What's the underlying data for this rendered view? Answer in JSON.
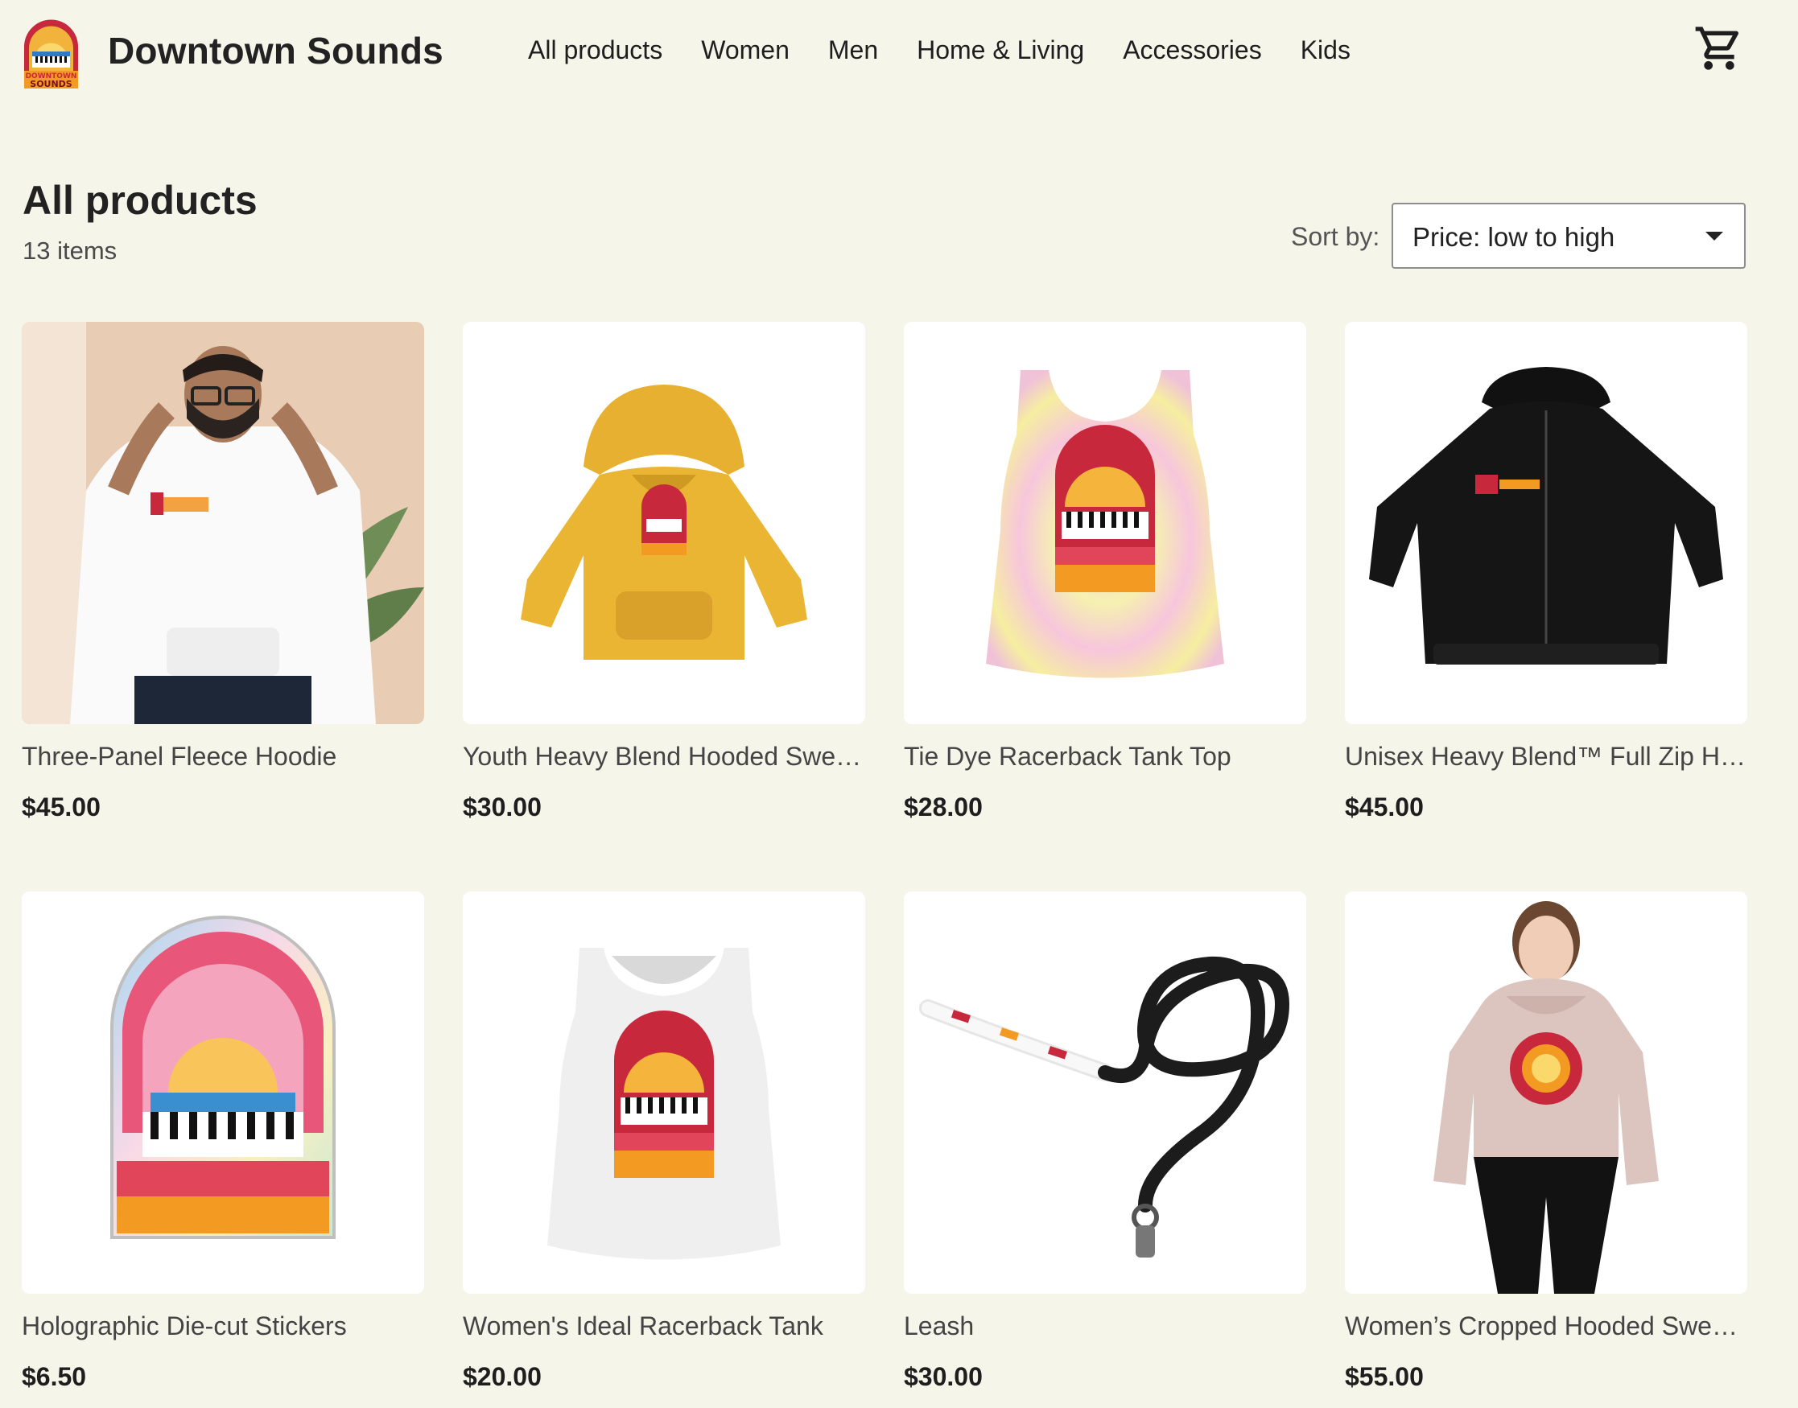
{
  "header": {
    "brand": "Downtown Sounds",
    "logo_text": [
      "DOWNTOWN",
      "SOUNDS"
    ],
    "nav": [
      "All products",
      "Women",
      "Men",
      "Home & Living",
      "Accessories",
      "Kids"
    ]
  },
  "catalog": {
    "title": "All products",
    "count": "13 items",
    "sort_label": "Sort by:",
    "sort_value": "Price: low to high"
  },
  "products": [
    {
      "name": "Three-Panel Fleece Hoodie",
      "price": "$45.00"
    },
    {
      "name": "Youth Heavy Blend Hooded Sweatshirt",
      "price": "$30.00"
    },
    {
      "name": "Tie Dye Racerback Tank Top",
      "price": "$28.00"
    },
    {
      "name": "Unisex Heavy Blend™ Full Zip Hooded Sweatshirt",
      "price": "$45.00"
    },
    {
      "name": "Holographic Die-cut Stickers",
      "price": "$6.50"
    },
    {
      "name": "Women's Ideal Racerback Tank",
      "price": "$20.00"
    },
    {
      "name": "Leash",
      "price": "$30.00"
    },
    {
      "name": "Women’s Cropped Hooded Sweatshirt",
      "price": "$55.00"
    }
  ],
  "colors": {
    "page_bg": "#f5f5ea",
    "card_bg": "#ffffff",
    "hoodie_yellow": "#eab533",
    "hoodie_black": "#151515",
    "logo_red": "#c8283c",
    "logo_orange": "#f39a23"
  }
}
